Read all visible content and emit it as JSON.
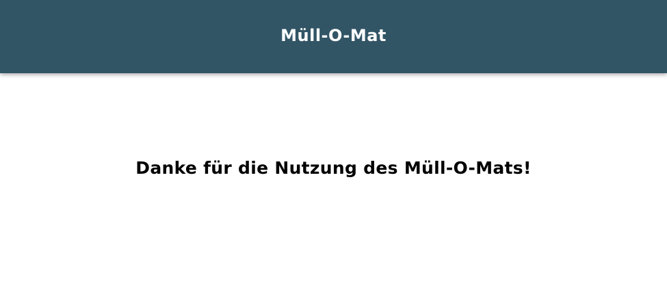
{
  "header": {
    "title": "Müll-O-Mat"
  },
  "main": {
    "message": "Danke für die Nutzung des Müll-O-Mats!"
  },
  "colors": {
    "header_background": "#325566",
    "header_text": "#ffffff",
    "page_background": "#ffffff",
    "message_text": "#000000"
  }
}
